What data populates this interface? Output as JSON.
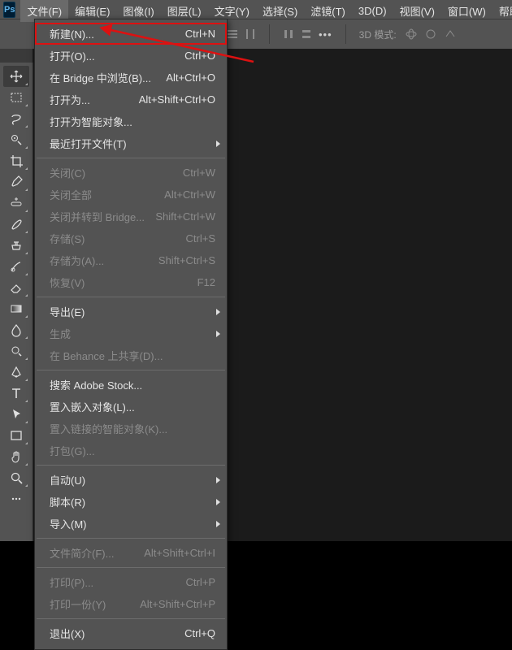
{
  "app_badge": "Ps",
  "menubar": [
    "文件(F)",
    "编辑(E)",
    "图像(I)",
    "图层(L)",
    "文字(Y)",
    "选择(S)",
    "滤镜(T)",
    "3D(D)",
    "视图(V)",
    "窗口(W)",
    "帮助(H)"
  ],
  "active_menu_index": 0,
  "options_bar": {
    "mode_label": "3D 模式:"
  },
  "file_menu": [
    {
      "label": "新建(N)...",
      "shortcut": "Ctrl+N",
      "highlight": true
    },
    {
      "label": "打开(O)...",
      "shortcut": "Ctrl+O"
    },
    {
      "label": "在 Bridge 中浏览(B)...",
      "shortcut": "Alt+Ctrl+O"
    },
    {
      "label": "打开为...",
      "shortcut": "Alt+Shift+Ctrl+O"
    },
    {
      "label": "打开为智能对象..."
    },
    {
      "label": "最近打开文件(T)",
      "submenu": true
    },
    {
      "sep": true
    },
    {
      "label": "关闭(C)",
      "shortcut": "Ctrl+W",
      "disabled": true
    },
    {
      "label": "关闭全部",
      "shortcut": "Alt+Ctrl+W",
      "disabled": true
    },
    {
      "label": "关闭并转到 Bridge...",
      "shortcut": "Shift+Ctrl+W",
      "disabled": true
    },
    {
      "label": "存储(S)",
      "shortcut": "Ctrl+S",
      "disabled": true
    },
    {
      "label": "存储为(A)...",
      "shortcut": "Shift+Ctrl+S",
      "disabled": true
    },
    {
      "label": "恢复(V)",
      "shortcut": "F12",
      "disabled": true
    },
    {
      "sep": true
    },
    {
      "label": "导出(E)",
      "submenu": true
    },
    {
      "label": "生成",
      "submenu": true,
      "disabled": true
    },
    {
      "label": "在 Behance 上共享(D)...",
      "disabled": true
    },
    {
      "sep": true
    },
    {
      "label": "搜索 Adobe Stock..."
    },
    {
      "label": "置入嵌入对象(L)..."
    },
    {
      "label": "置入链接的智能对象(K)...",
      "disabled": true
    },
    {
      "label": "打包(G)...",
      "disabled": true
    },
    {
      "sep": true
    },
    {
      "label": "自动(U)",
      "submenu": true
    },
    {
      "label": "脚本(R)",
      "submenu": true
    },
    {
      "label": "导入(M)",
      "submenu": true
    },
    {
      "sep": true
    },
    {
      "label": "文件简介(F)...",
      "shortcut": "Alt+Shift+Ctrl+I",
      "disabled": true
    },
    {
      "sep": true
    },
    {
      "label": "打印(P)...",
      "shortcut": "Ctrl+P",
      "disabled": true
    },
    {
      "label": "打印一份(Y)",
      "shortcut": "Alt+Shift+Ctrl+P",
      "disabled": true
    },
    {
      "sep": true
    },
    {
      "label": "退出(X)",
      "shortcut": "Ctrl+Q"
    }
  ],
  "tools": [
    {
      "name": "move-tool",
      "selected": true
    },
    {
      "name": "rectangular-marquee-tool"
    },
    {
      "name": "lasso-tool"
    },
    {
      "name": "quick-selection-tool"
    },
    {
      "name": "crop-tool"
    },
    {
      "name": "eyedropper-tool"
    },
    {
      "name": "spot-healing-brush-tool"
    },
    {
      "name": "brush-tool"
    },
    {
      "name": "clone-stamp-tool"
    },
    {
      "name": "history-brush-tool"
    },
    {
      "name": "eraser-tool"
    },
    {
      "name": "gradient-tool"
    },
    {
      "name": "blur-tool"
    },
    {
      "name": "dodge-tool"
    },
    {
      "name": "pen-tool"
    },
    {
      "name": "horizontal-type-tool"
    },
    {
      "name": "path-selection-tool"
    },
    {
      "name": "rectangle-tool"
    },
    {
      "name": "hand-tool"
    },
    {
      "name": "zoom-tool"
    },
    {
      "name": "more-tools",
      "nofly": true
    }
  ]
}
